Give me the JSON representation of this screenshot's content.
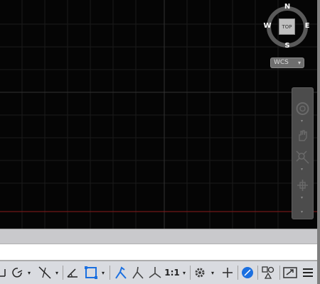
{
  "viewcube": {
    "north": "N",
    "south": "S",
    "east": "E",
    "west": "W",
    "face": "TOP"
  },
  "wcs": {
    "label": "WCS",
    "caret": "▾"
  },
  "statusbar": {
    "annotation_scale": "1:1",
    "caret": "▾"
  },
  "colors": {
    "viewport_bg": "#050505",
    "crosshair_x": "#8b1a1a",
    "status_active": "#1a6fe0"
  },
  "icons": [
    "polar-tracking-icon",
    "object-snap-tracking-icon",
    "dynamic-ucs-icon",
    "selection-cycling-icon",
    "annotation-visibility-icon",
    "auto-scale-icon",
    "annotation-scale-icon",
    "workspace-gear-icon",
    "plus-icon",
    "hardware-acceleration-icon",
    "isolate-objects-icon",
    "fullscreen-icon",
    "customization-menu-icon",
    "steering-wheel-icon",
    "pan-icon",
    "zoom-extents-icon",
    "orbit-icon"
  ]
}
